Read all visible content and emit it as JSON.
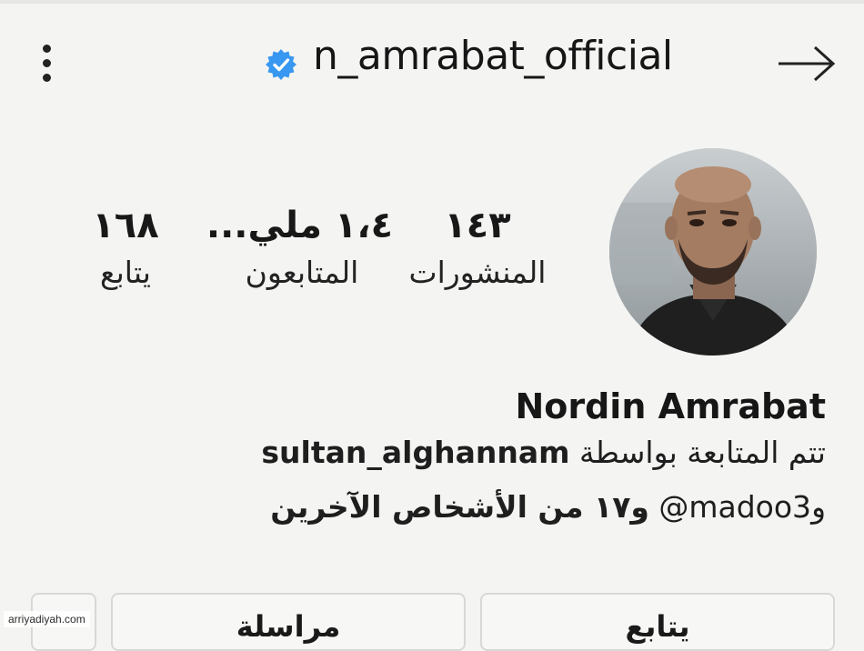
{
  "header": {
    "username": "n_amrabat_official",
    "icons": {
      "menu": "more-vertical-icon",
      "verified": "verified-badge-icon",
      "back": "arrow-right-icon"
    },
    "verified_color": "#3897f0"
  },
  "stats": {
    "posts": {
      "value": "١٤٣",
      "label": "المنشورات"
    },
    "followers": {
      "value": "١،٤ ملي...",
      "label": "المتابعون"
    },
    "following": {
      "value": "١٦٨",
      "label": "يتابع"
    }
  },
  "profile": {
    "full_name": "Nordin Amrabat",
    "followed_by_prefix": "تتم المتابعة بواسطة",
    "followed_by_user": "sultan_alghannam",
    "and_prefix": "و",
    "other_user": "@madoo3",
    "others_suffix": "و١٧ من الأشخاص الآخرين"
  },
  "actions": {
    "follow_label": "يتابع",
    "message_label": "مراسلة"
  },
  "watermark": "arriyadiyah.com"
}
